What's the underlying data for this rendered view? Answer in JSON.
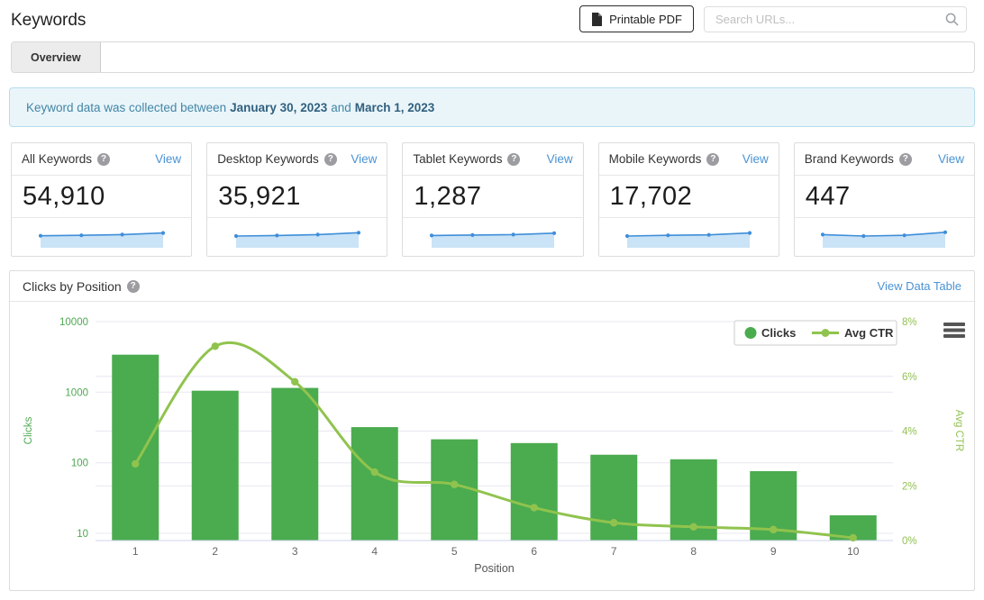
{
  "page": {
    "title": "Keywords"
  },
  "header": {
    "pdf_button": {
      "label": "Printable PDF",
      "icon": "file-icon"
    },
    "search": {
      "placeholder": "Search URLs...",
      "icon": "search-icon"
    }
  },
  "tabs": [
    {
      "label": "Overview",
      "active": true
    }
  ],
  "banner": {
    "text_prefix": "Keyword data was collected between",
    "date_start": "January 30, 2023",
    "text_middle": "and",
    "date_end": "March 1, 2023"
  },
  "stat_cards": [
    {
      "title": "All Keywords",
      "view_label": "View",
      "value": "54,910",
      "trend": [
        0.45,
        0.43,
        0.4,
        0.33
      ]
    },
    {
      "title": "Desktop Keywords",
      "view_label": "View",
      "value": "35,921",
      "trend": [
        0.46,
        0.44,
        0.4,
        0.32
      ]
    },
    {
      "title": "Tablet Keywords",
      "view_label": "View",
      "value": "1,287",
      "trend": [
        0.44,
        0.42,
        0.4,
        0.34
      ]
    },
    {
      "title": "Mobile Keywords",
      "view_label": "View",
      "value": "17,702",
      "trend": [
        0.46,
        0.43,
        0.41,
        0.33
      ]
    },
    {
      "title": "Brand Keywords",
      "view_label": "View",
      "value": "447",
      "trend": [
        0.4,
        0.46,
        0.43,
        0.3
      ]
    }
  ],
  "sparkline_colors": {
    "line": "#3f8ed9",
    "fill": "#cae3f6"
  },
  "chart_panel": {
    "title": "Clicks by Position",
    "link_label": "View Data Table"
  },
  "chart_data": {
    "type": "bar+line combo",
    "categories": [
      1,
      2,
      3,
      4,
      5,
      6,
      7,
      8,
      9,
      10
    ],
    "series": [
      {
        "name": "Clicks",
        "type": "bar",
        "axis": "left",
        "color": "#4bab4f",
        "values": [
          3400,
          1050,
          1150,
          320,
          215,
          190,
          130,
          112,
          76,
          18
        ]
      },
      {
        "name": "Avg CTR",
        "type": "line",
        "axis": "right",
        "color": "#90c34e",
        "values": [
          2.8,
          7.1,
          5.8,
          2.5,
          2.05,
          1.2,
          0.65,
          0.5,
          0.4,
          0.1
        ]
      }
    ],
    "xlabel": "Position",
    "y_left": {
      "label": "Clicks",
      "scale": "log",
      "ticks": [
        10,
        100,
        1000,
        10000
      ],
      "label_color": "#4fa852"
    },
    "y_right": {
      "label": "Avg CTR",
      "scale": "linear",
      "min": 0,
      "max": 8,
      "tick_values": [
        0,
        2,
        4,
        6,
        8
      ],
      "tick_labels": [
        "0%",
        "2%",
        "4%",
        "6%",
        "8%"
      ],
      "label_color": "#93c154"
    },
    "legend": {
      "position": "top-right",
      "entries": [
        "Clicks",
        "Avg CTR"
      ]
    },
    "grid": {
      "on": true,
      "color": "#e7e7f1",
      "axis_line_color": "#ccd6eb"
    },
    "x_tick_color": "#666666",
    "menu_icon": "menu-icon"
  }
}
